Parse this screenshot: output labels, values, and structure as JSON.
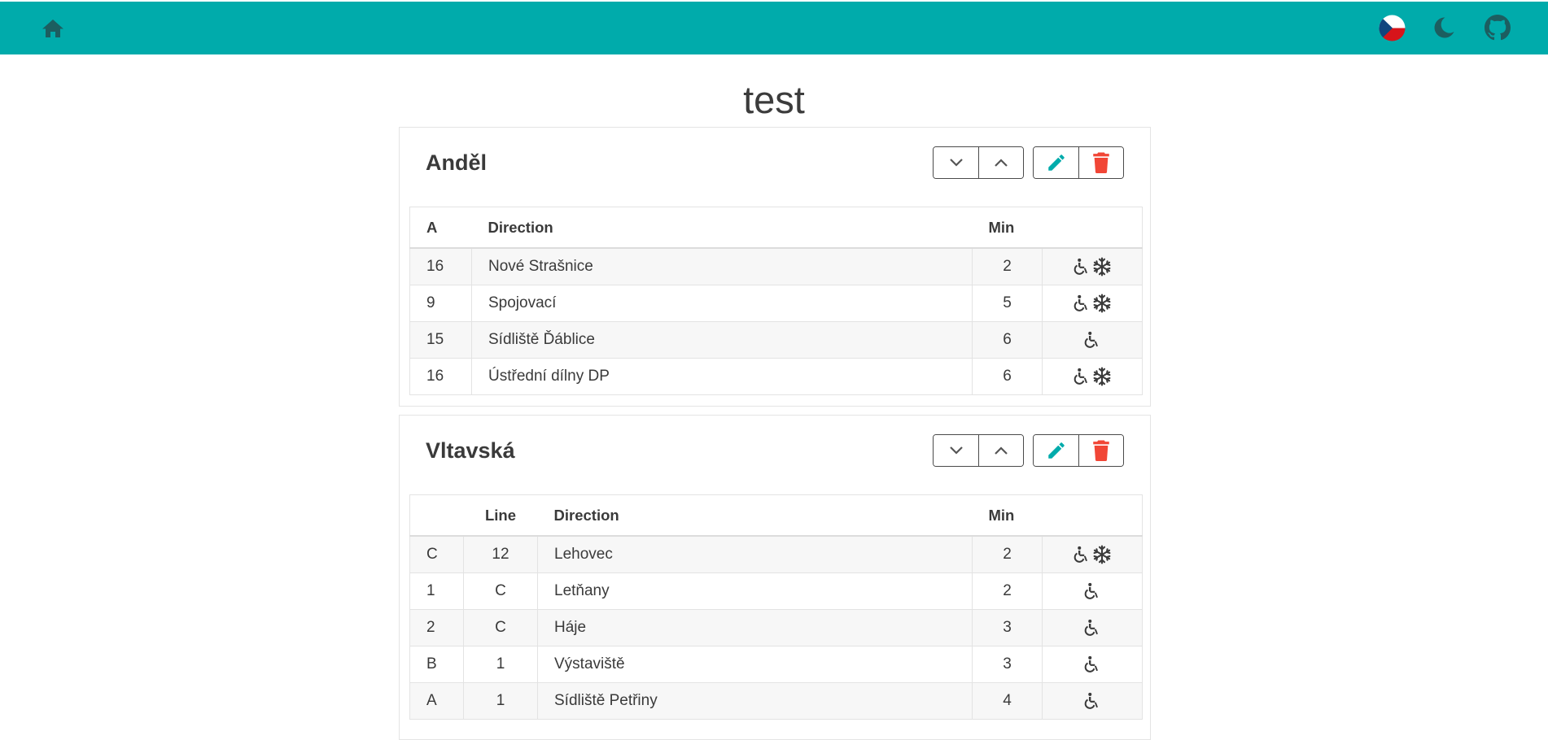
{
  "header": {
    "brand_color": "#00abab",
    "home_icon": "home-icon",
    "language_flag": "czech-flag-icon",
    "theme_icon": "moon-icon",
    "repo_icon": "github-icon"
  },
  "page": {
    "title": "test"
  },
  "stops": [
    {
      "name": "Anděl",
      "columns": [
        "A",
        "Direction",
        "Min",
        ""
      ],
      "rows": [
        {
          "platform": "16",
          "direction": "Nové Strašnice",
          "min": "2",
          "wheelchair": true,
          "ac": true
        },
        {
          "platform": "9",
          "direction": "Spojovací",
          "min": "5",
          "wheelchair": true,
          "ac": true
        },
        {
          "platform": "15",
          "direction": "Sídliště Ďáblice",
          "min": "6",
          "wheelchair": true,
          "ac": false
        },
        {
          "platform": "16",
          "direction": "Ústřední dílny DP",
          "min": "6",
          "wheelchair": true,
          "ac": true
        }
      ]
    },
    {
      "name": "Vltavská",
      "columns": [
        "",
        "Line",
        "Direction",
        "Min",
        ""
      ],
      "rows": [
        {
          "platform": "C",
          "line": "12",
          "direction": "Lehovec",
          "min": "2",
          "wheelchair": true,
          "ac": true
        },
        {
          "platform": "1",
          "line": "C",
          "direction": "Letňany",
          "min": "2",
          "wheelchair": true,
          "ac": false
        },
        {
          "platform": "2",
          "line": "C",
          "direction": "Háje",
          "min": "3",
          "wheelchair": true,
          "ac": false
        },
        {
          "platform": "B",
          "line": "1",
          "direction": "Výstaviště",
          "min": "3",
          "wheelchair": true,
          "ac": false
        },
        {
          "platform": "A",
          "line": "1",
          "direction": "Sídliště Petřiny",
          "min": "4",
          "wheelchair": true,
          "ac": false
        }
      ]
    }
  ],
  "colors": {
    "edit": "#00abab",
    "delete": "#f14636",
    "text": "#363636"
  }
}
